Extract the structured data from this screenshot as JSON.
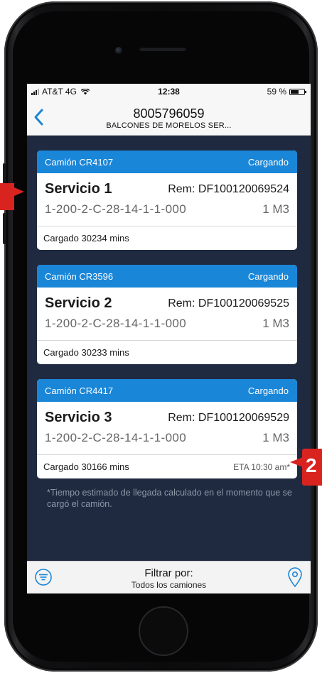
{
  "status_bar": {
    "carrier": "AT&T 4G",
    "time": "12:38",
    "battery": "59 %",
    "battery_level": 0.59
  },
  "nav": {
    "title": "8005796059",
    "subtitle": "BALCONES DE MORELOS SER..."
  },
  "cards": [
    {
      "truck": "Camión CR4107",
      "status": "Cargando",
      "service": "Servicio 1",
      "rem": "Rem: DF100120069524",
      "code": "1-200-2-C-28-14-1-1-000",
      "quantity": "1 M3",
      "loaded": "Cargado 30234 mins",
      "eta": ""
    },
    {
      "truck": "Camión CR3596",
      "status": "Cargando",
      "service": "Servicio 2",
      "rem": "Rem: DF100120069525",
      "code": "1-200-2-C-28-14-1-1-000",
      "quantity": "1 M3",
      "loaded": "Cargado 30233 mins",
      "eta": ""
    },
    {
      "truck": "Camión CR4417",
      "status": "Cargando",
      "service": "Servicio 3",
      "rem": "Rem: DF100120069529",
      "code": "1-200-2-C-28-14-1-1-000",
      "quantity": "1 M3",
      "loaded": "Cargado 30166 mins",
      "eta": "ETA 10:30 am*"
    }
  ],
  "footnote": "*Tiempo estimado de llegada calculado en el momento que se cargó el camión.",
  "filter_bar": {
    "title": "Filtrar por:",
    "value": "Todos los camiones"
  },
  "callouts": {
    "second_label": "2"
  },
  "colors": {
    "screen_background": "#1f2a40",
    "card_header": "#1a86d8",
    "ios_blue": "#1a86d8",
    "callout_red": "#d8231f"
  },
  "icons": {
    "back": "chevron-left-icon",
    "filter": "filter-lines-icon",
    "location": "location-pin-icon"
  }
}
